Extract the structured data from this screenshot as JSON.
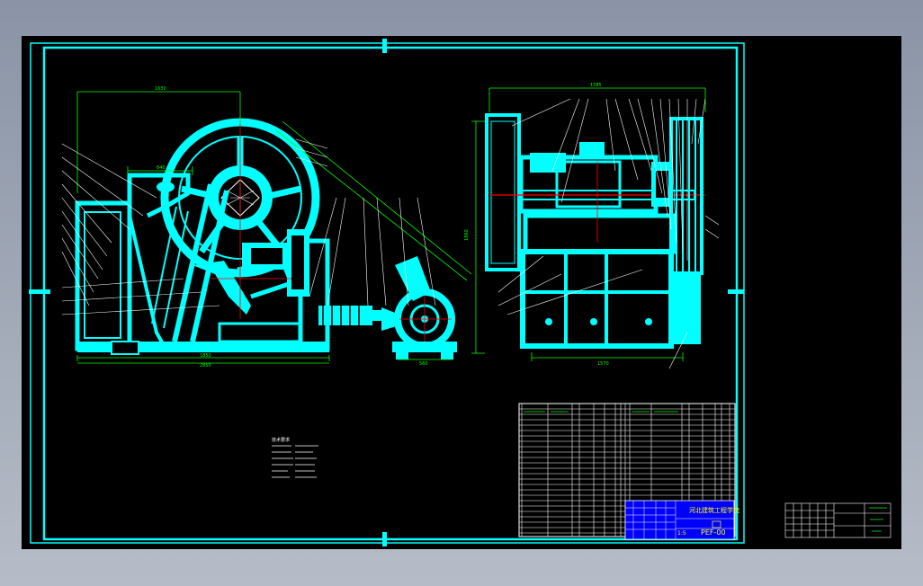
{
  "drawing": {
    "title_block": {
      "school": "河北建筑工程学院",
      "drawing_number": "PEF-00",
      "scale": "1:5"
    },
    "tech_requirements_heading": "技术要求",
    "dimensions": {
      "front_top": "1630",
      "front_feed": "640",
      "front_bottom_1": "1850",
      "front_bottom_2": "2850",
      "motor_base": "560",
      "side_top": "1585",
      "side_bottom": "1570",
      "side_height": "1860"
    }
  },
  "colors": {
    "line_main": "#00ffff",
    "line_thin": "#ffffff",
    "dimension": "#00ff00",
    "centerline": "#ff0000",
    "title_fill": "#0000ff",
    "title_text": "#ffff00"
  }
}
